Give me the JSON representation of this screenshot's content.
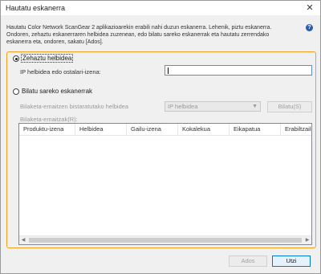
{
  "window": {
    "title": "Hautatu eskanerra",
    "close_glyph": "✕",
    "description": "Hautatu Color Network ScanGear 2 aplikazioarekin erabili nahi duzun eskanerra. Lehenik, piztu eskanerra. Ondoren, zehaztu eskanerraren helbidea zuzenean, edo bilatu sareko eskanerrak eta hautatu zerrendako eskanerra eta, ondoren, sakatu [Ados].",
    "help_glyph": "?"
  },
  "specify": {
    "radio_label": "Zehaztu helbidea",
    "selected": true,
    "ip_label": "IP helbidea edo ostalari-izena:",
    "ip_value": ""
  },
  "search": {
    "radio_label": "Bilatu sareko eskanerrak",
    "selected": false,
    "condition_label": "Bilaketa-emaitzen bistaratutako helbidea",
    "address_type": "IP helbidea",
    "search_button": "Bilatu(S)",
    "results_label": "Bilaketa-emaitzak(R):"
  },
  "table": {
    "columns": [
      "Produktu-izena",
      "Helbidea",
      "Gailu-izena",
      "Kokalekua",
      "Eikapatua",
      "Erabiltzailea"
    ],
    "rows": []
  },
  "footer": {
    "ok_label": "Ados",
    "cancel_label": "Utzi"
  },
  "colors": {
    "accent": "#f0a020",
    "focus_border": "#0078d7",
    "help_icon": "#2a5db0"
  }
}
